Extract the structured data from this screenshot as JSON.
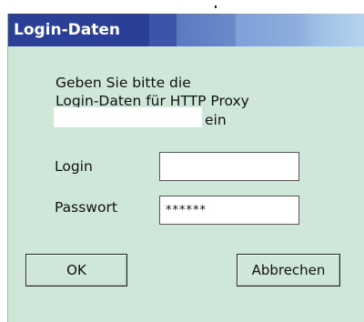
{
  "window": {
    "title": "Login-Daten"
  },
  "message": {
    "line1": "Geben Sie bitte die",
    "line2": "Login-Daten für  HTTP Proxy",
    "line3": "ein"
  },
  "form": {
    "login_label": "Login",
    "login_value": "",
    "password_label": "Passwort",
    "password_value": "******"
  },
  "buttons": {
    "ok": "OK",
    "cancel": "Abbrechen"
  },
  "colors": {
    "title_bar": "#2a3f95",
    "dialog_bg": "#cfe7d8"
  }
}
